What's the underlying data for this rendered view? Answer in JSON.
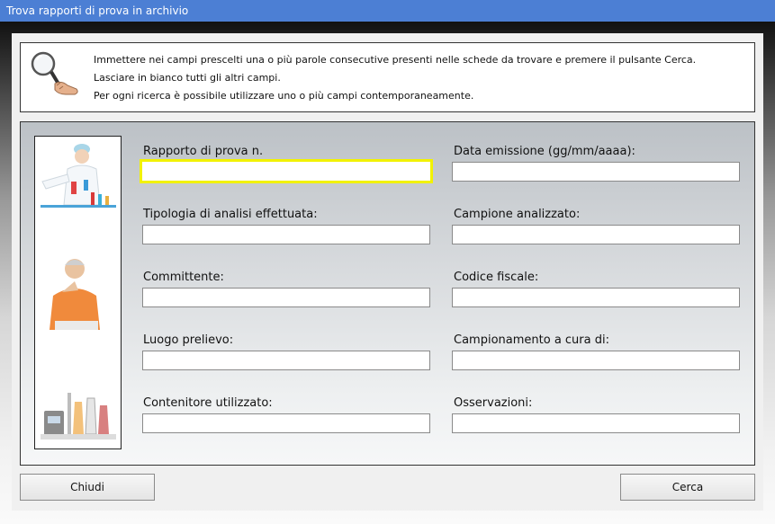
{
  "window": {
    "title": "Trova rapporti di prova in archivio"
  },
  "info": {
    "icon": "magnifier-icon",
    "lines": [
      "Immettere nei campi prescelti una o più parole consecutive presenti nelle schede da trovare e premere il pulsante Cerca.",
      "Lasciare in bianco tutti gli altri campi.",
      "Per ogni ricerca è possibile utilizzare uno o più campi contemporaneamente."
    ]
  },
  "form": {
    "fields": [
      {
        "label": "Rapporto di prova n.",
        "value": "",
        "focused": true
      },
      {
        "label": "Data emissione (gg/mm/aaaa):",
        "value": ""
      },
      {
        "label": "Tipologia di analisi effettuata:",
        "value": ""
      },
      {
        "label": "Campione analizzato:",
        "value": ""
      },
      {
        "label": "Committente:",
        "value": ""
      },
      {
        "label": "Codice fiscale:",
        "value": ""
      },
      {
        "label": "Luogo prelievo:",
        "value": ""
      },
      {
        "label": "Campionamento a cura di:",
        "value": ""
      },
      {
        "label": "Contenitore utilizzato:",
        "value": ""
      },
      {
        "label": "Osservazioni:",
        "value": ""
      }
    ],
    "focus_color": "#f2f200"
  },
  "side_images": [
    "lab-technician-image",
    "client-man-image",
    "lab-equipment-image"
  ],
  "buttons": {
    "close_label": "Chiudi",
    "search_label": "Cerca"
  }
}
